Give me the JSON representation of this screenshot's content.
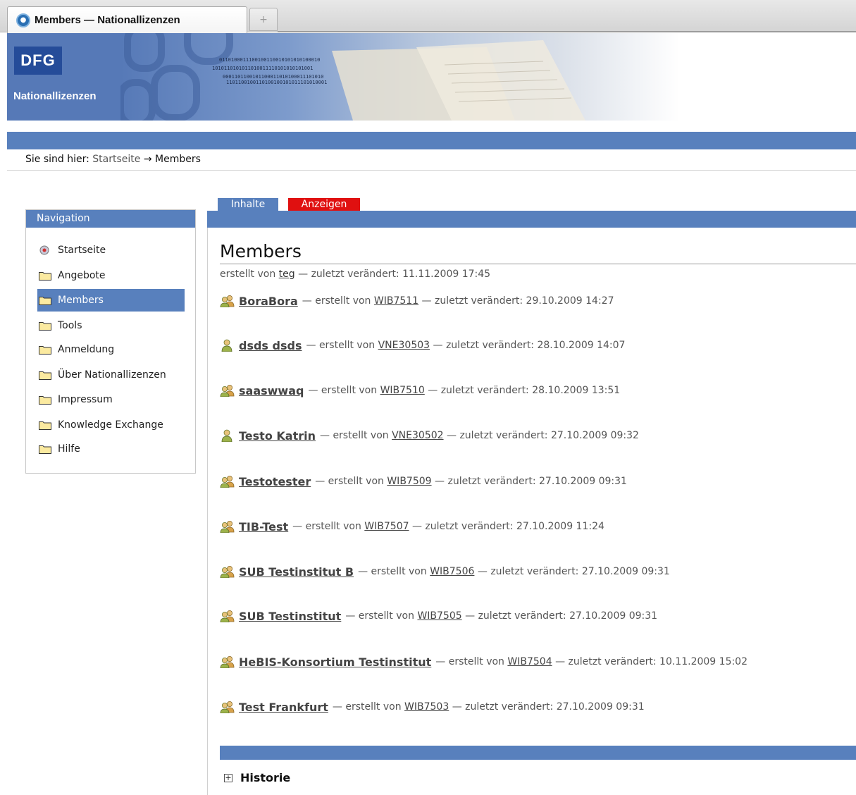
{
  "browser": {
    "tab_title": "Members — Nationallizenzen",
    "new_tab_symbol": "+"
  },
  "header": {
    "logo_text": "DFG",
    "site_name": "Nationallizenzen"
  },
  "breadcrumb": {
    "prefix": "Sie sind hier:",
    "home": "Startseite",
    "arrow": "→",
    "current": "Members"
  },
  "navigation": {
    "title": "Navigation",
    "items": [
      {
        "label": "Startseite",
        "icon": "home-icon"
      },
      {
        "label": "Angebote",
        "icon": "folder-icon"
      },
      {
        "label": "Members",
        "icon": "folder-icon",
        "active": true
      },
      {
        "label": "Tools",
        "icon": "folder-icon"
      },
      {
        "label": "Anmeldung",
        "icon": "folder-icon"
      },
      {
        "label": "Über Nationallizenzen",
        "icon": "folder-icon"
      },
      {
        "label": "Impressum",
        "icon": "folder-icon"
      },
      {
        "label": "Knowledge Exchange",
        "icon": "folder-icon"
      },
      {
        "label": "Hilfe",
        "icon": "folder-icon"
      }
    ]
  },
  "content_tabs": {
    "inhalte": "Inhalte",
    "anzeigen": "Anzeigen"
  },
  "page": {
    "title": "Members",
    "byline_prefix": "erstellt von",
    "byline_author": "teg",
    "byline_modified": "— zuletzt verändert: 11.11.2009 17:45"
  },
  "members": [
    {
      "name": "BoraBora",
      "created_by": "WIB7511",
      "modified": "29.10.2009 14:27",
      "icon": "group-icon"
    },
    {
      "name": "dsds dsds",
      "created_by": "VNE30503",
      "modified": "28.10.2009 14:07",
      "icon": "user-icon"
    },
    {
      "name": "saaswwaq",
      "created_by": "WIB7510",
      "modified": "28.10.2009 13:51",
      "icon": "group-icon"
    },
    {
      "name": "Testo Katrin",
      "created_by": "VNE30502",
      "modified": "27.10.2009 09:32",
      "icon": "user-icon"
    },
    {
      "name": "Testotester",
      "created_by": "WIB7509",
      "modified": "27.10.2009 09:31",
      "icon": "group-icon"
    },
    {
      "name": "TIB-Test",
      "created_by": "WIB7507",
      "modified": "27.10.2009 11:24",
      "icon": "group-icon"
    },
    {
      "name": "SUB Testinstitut B",
      "created_by": "WIB7506",
      "modified": "27.10.2009 09:31",
      "icon": "group-icon"
    },
    {
      "name": "SUB Testinstitut",
      "created_by": "WIB7505",
      "modified": "27.10.2009 09:31",
      "icon": "group-icon"
    },
    {
      "name": "HeBIS-Konsortium Testinstitut",
      "created_by": "WIB7504",
      "modified": "10.11.2009 15:02",
      "icon": "group-icon"
    },
    {
      "name": "Test Frankfurt",
      "created_by": "WIB7503",
      "modified": "27.10.2009 09:31",
      "icon": "group-icon"
    }
  ],
  "labels": {
    "dash": "—",
    "created_by": "erstellt von",
    "modified": "zuletzt verändert:"
  },
  "footer": {
    "toggle_symbol": "+",
    "historie": "Historie"
  },
  "colors": {
    "accent_blue": "#5880bd",
    "logo_blue": "#254c99",
    "anzeigen_red": "#e01010"
  }
}
